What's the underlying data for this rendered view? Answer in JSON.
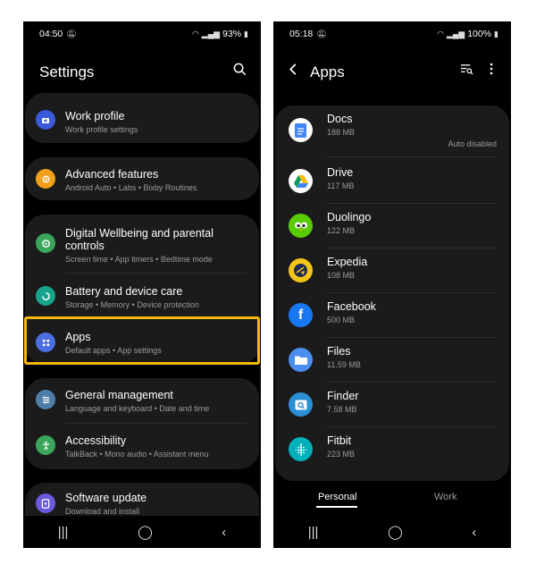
{
  "left": {
    "status": {
      "time": "04:50",
      "battery": "93%"
    },
    "title": "Settings",
    "items": [
      {
        "title": "Work profile",
        "subtitle": "Work profile settings",
        "icon": "work-profile-icon",
        "color": "#3a5bd9"
      },
      {
        "title": "Advanced features",
        "subtitle": "Android Auto  •  Labs  •  Bixby Routines",
        "icon": "gear-plus-icon",
        "color": "#f2a01a"
      },
      {
        "title": "Digital Wellbeing and parental controls",
        "subtitle": "Screen time  •  App timers  •  Bedtime mode",
        "icon": "wellbeing-icon",
        "color": "#3ba55c"
      },
      {
        "title": "Battery and device care",
        "subtitle": "Storage  •  Memory  •  Device protection",
        "icon": "device-care-icon",
        "color": "#18a38c"
      },
      {
        "title": "Apps",
        "subtitle": "Default apps  •  App settings",
        "icon": "apps-icon",
        "color": "#4a6fe0"
      },
      {
        "title": "General management",
        "subtitle": "Language and keyboard  •  Date and time",
        "icon": "sliders-icon",
        "color": "#4e7fa8"
      },
      {
        "title": "Accessibility",
        "subtitle": "TalkBack  •  Mono audio  •  Assistant menu",
        "icon": "accessibility-icon",
        "color": "#3ba55c"
      },
      {
        "title": "Software update",
        "subtitle": "Download and install",
        "icon": "software-update-icon",
        "color": "#6a5ae0"
      }
    ]
  },
  "right": {
    "status": {
      "time": "05:18",
      "battery": "100%"
    },
    "title": "Apps",
    "apps": [
      {
        "name": "Docs",
        "size": "188 MB",
        "note": "Auto disabled",
        "icon": "docs-icon",
        "color": "#4285f4"
      },
      {
        "name": "Drive",
        "size": "117 MB",
        "icon": "drive-icon",
        "color": "#ffffff"
      },
      {
        "name": "Duolingo",
        "size": "122 MB",
        "icon": "duolingo-icon",
        "color": "#58cc02"
      },
      {
        "name": "Expedia",
        "size": "108 MB",
        "icon": "expedia-icon",
        "color": "#f5c518"
      },
      {
        "name": "Facebook",
        "size": "500 MB",
        "icon": "facebook-icon",
        "color": "#1877f2"
      },
      {
        "name": "Files",
        "size": "11.59 MB",
        "icon": "files-icon",
        "color": "#4a8ef0"
      },
      {
        "name": "Finder",
        "size": "7.58 MB",
        "icon": "finder-icon",
        "color": "#2b8fd6"
      },
      {
        "name": "Fitbit",
        "size": "223 MB",
        "icon": "fitbit-icon",
        "color": "#00b0b9"
      }
    ],
    "tabs": {
      "personal": "Personal",
      "work": "Work"
    }
  }
}
